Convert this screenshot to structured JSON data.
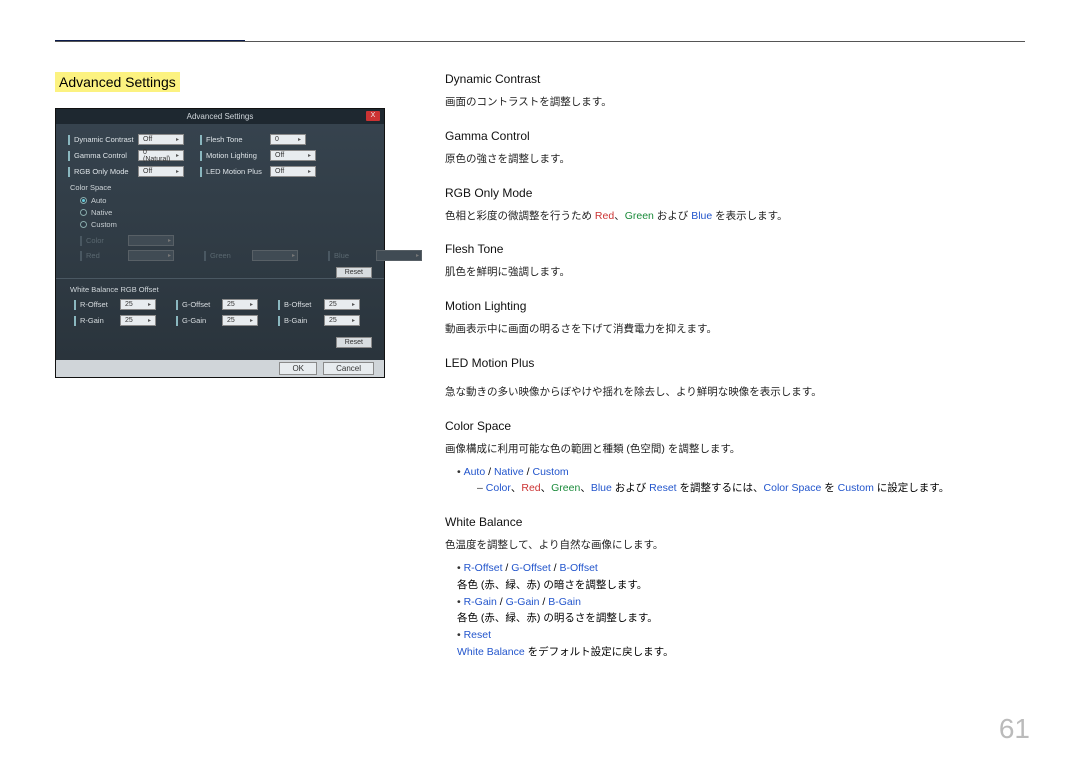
{
  "page_number": "61",
  "section_title": "Advanced Settings",
  "dialog": {
    "title": "Advanced Settings",
    "fields": {
      "dynamic_contrast": {
        "label": "Dynamic Contrast",
        "value": "Off"
      },
      "flesh_tone": {
        "label": "Flesh Tone",
        "value": "0"
      },
      "gamma_control": {
        "label": "Gamma Control",
        "value": "0 (Natural)"
      },
      "motion_lighting": {
        "label": "Motion Lighting",
        "value": "Off"
      },
      "rgb_only_mode": {
        "label": "RGB Only Mode",
        "value": "Off"
      },
      "led_motion_plus": {
        "label": "LED Motion Plus",
        "value": "Off"
      }
    },
    "color_space": {
      "label": "Color Space",
      "options": {
        "auto": "Auto",
        "native": "Native",
        "custom": "Custom"
      },
      "disabled": {
        "color": "Color",
        "red": "Red",
        "green": "Green",
        "blue": "Blue"
      },
      "reset": "Reset"
    },
    "white_balance": {
      "label": "White Balance RGB Offset",
      "r_offset": {
        "label": "R-Offset",
        "value": "25"
      },
      "g_offset": {
        "label": "G-Offset",
        "value": "25"
      },
      "b_offset": {
        "label": "B-Offset",
        "value": "25"
      },
      "r_gain": {
        "label": "R-Gain",
        "value": "25"
      },
      "g_gain": {
        "label": "G-Gain",
        "value": "25"
      },
      "b_gain": {
        "label": "B-Gain",
        "value": "25"
      },
      "reset": "Reset"
    },
    "ok": "OK",
    "cancel": "Cancel"
  },
  "right": {
    "dynamic_contrast": {
      "h": "Dynamic Contrast",
      "d": "画面のコントラストを調整します。"
    },
    "gamma_control": {
      "h": "Gamma Control",
      "d": "原色の強さを調整します。"
    },
    "rgb_only_mode": {
      "h": "RGB Only Mode",
      "d_pre": "色相と彩度の微調整を行うため ",
      "red": "Red",
      "c1": "、",
      "green": "Green",
      "c2": " および ",
      "blue": "Blue",
      "d_post": " を表示します。"
    },
    "flesh_tone": {
      "h": "Flesh Tone",
      "d": "肌色を鮮明に強調します。"
    },
    "motion_lighting": {
      "h": "Motion Lighting",
      "d": "動画表示中に画面の明るさを下げて消費電力を抑えます。"
    },
    "led_motion_plus": {
      "h": "LED Motion Plus",
      "d": "急な動きの多い映像からぼやけや揺れを除去し、より鮮明な映像を表示します。"
    },
    "color_space": {
      "h": "Color Space",
      "d": "画像構成に利用可能な色の範囲と種類 (色空間) を調整します。",
      "l1_auto": "Auto",
      "l1_sep": " / ",
      "l1_native": "Native",
      "l1_custom": "Custom",
      "l2_color": "Color",
      "l2_red": "Red",
      "l2_green": "Green",
      "l2_blue": "Blue",
      "l2_mid1": " および ",
      "l2_reset": "Reset",
      "l2_mid2": " を調整するには、",
      "l2_colorspace": "Color Space",
      "l2_mid3": " を ",
      "l2_custom": "Custom",
      "l2_end": " に設定します。",
      "sep": "、"
    },
    "white_balance": {
      "h": "White Balance",
      "d": "色温度を調整して、より自然な画像にします。",
      "b1_r": "R-Offset",
      "b1_g": "G-Offset",
      "b1_b": "B-Offset",
      "sep": " / ",
      "b1_d": "各色 (赤、緑、赤) の暗さを調整します。",
      "b2_r": "R-Gain",
      "b2_g": "G-Gain",
      "b2_b": "B-Gain",
      "b2_d": "各色 (赤、緑、赤) の明るさを調整します。",
      "b3_reset": "Reset",
      "b3_wb": "White Balance",
      "b3_end": " をデフォルト設定に戻します。"
    }
  }
}
